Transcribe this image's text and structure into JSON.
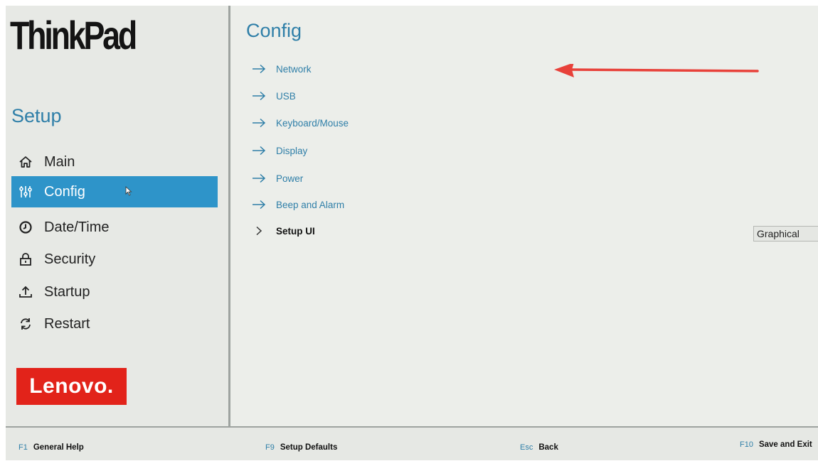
{
  "brand": "ThinkPad",
  "setup_title": "Setup",
  "sidebar": {
    "items": [
      {
        "label": "Main",
        "icon": "home-icon"
      },
      {
        "label": "Config",
        "icon": "sliders-icon"
      },
      {
        "label": "Date/Time",
        "icon": "clock-icon"
      },
      {
        "label": "Security",
        "icon": "lock-icon"
      },
      {
        "label": "Startup",
        "icon": "upload-icon"
      },
      {
        "label": "Restart",
        "icon": "restart-icon"
      }
    ],
    "active": "Config"
  },
  "vendor_logo": "Lenovo.",
  "page_title": "Config",
  "menu": {
    "items": [
      {
        "label": "Network",
        "icon": "arrow-right-icon"
      },
      {
        "label": "USB",
        "icon": "arrow-right-icon"
      },
      {
        "label": "Keyboard/Mouse",
        "icon": "arrow-right-icon"
      },
      {
        "label": "Display",
        "icon": "arrow-right-icon"
      },
      {
        "label": "Power",
        "icon": "arrow-right-icon"
      },
      {
        "label": "Beep and Alarm",
        "icon": "arrow-right-icon"
      }
    ],
    "setup_ui": {
      "label": "Setup UI",
      "icon": "chevron-right-icon",
      "value": "Graphical"
    }
  },
  "footer": {
    "help": {
      "key": "F1",
      "label": "General Help"
    },
    "defaults": {
      "key": "F9",
      "label": "Setup Defaults"
    },
    "back": {
      "key": "Esc",
      "label": "Back"
    },
    "save": {
      "key": "F10",
      "label": "Save and Exit"
    }
  },
  "colors": {
    "accent": "#2f7fa8",
    "active_bg": "#2e94c9",
    "lenovo_red": "#e2231a",
    "annotation_red": "#e8413a"
  }
}
